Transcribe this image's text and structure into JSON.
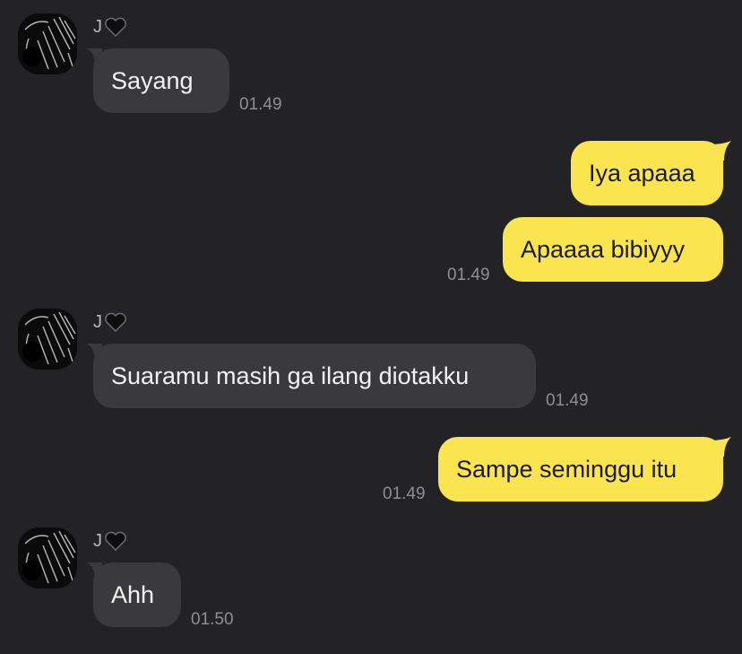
{
  "colors": {
    "background": "#232325",
    "incoming_bubble": "#3a3a3c",
    "outgoing_bubble": "#fae550",
    "timestamp": "#8f8f92"
  },
  "messages": [
    {
      "direction": "incoming",
      "sender": "J",
      "sender_icon": "black-heart-icon",
      "text": "Sayang",
      "time": "01.49"
    },
    {
      "direction": "outgoing",
      "text": "Iya apaaa"
    },
    {
      "direction": "outgoing",
      "text": "Apaaaa bibiyyy",
      "time": "01.49"
    },
    {
      "direction": "incoming",
      "sender": "J",
      "sender_icon": "black-heart-icon",
      "text": "Suaramu masih ga ilang diotakku",
      "time": "01.49"
    },
    {
      "direction": "outgoing",
      "text": "Sampe seminggu itu",
      "time": "01.49"
    },
    {
      "direction": "incoming",
      "sender": "J",
      "sender_icon": "black-heart-icon",
      "text": "Ahh",
      "time": "01.50"
    }
  ]
}
